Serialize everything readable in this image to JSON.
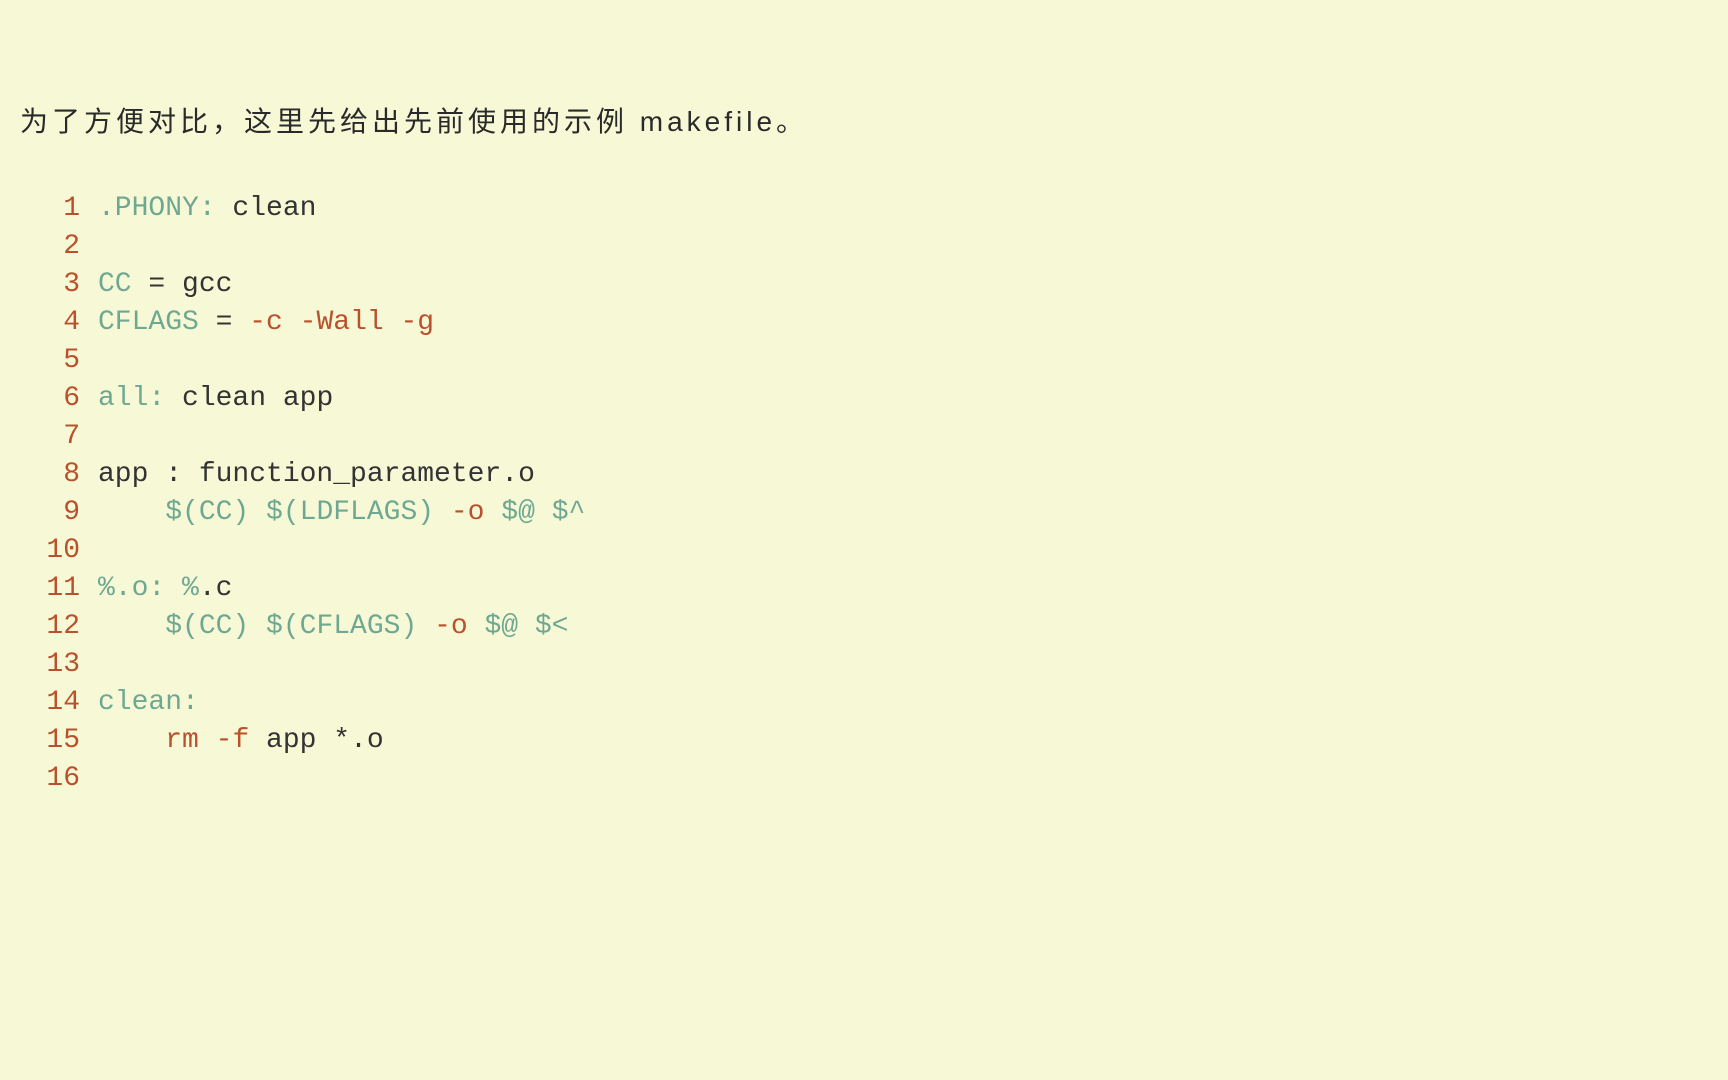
{
  "intro": "为了方便对比，这里先给出先前使用的示例 makefile。",
  "code": {
    "lines": [
      {
        "no": "1",
        "tokens": [
          {
            "t": ".PHONY:",
            "c": "tok-target"
          },
          {
            "t": " clean",
            "c": "tok-default"
          }
        ]
      },
      {
        "no": "2",
        "tokens": [
          {
            "t": "",
            "c": "tok-default"
          }
        ]
      },
      {
        "no": "3",
        "tokens": [
          {
            "t": "CC",
            "c": "tok-target"
          },
          {
            "t": " = gcc",
            "c": "tok-default"
          }
        ]
      },
      {
        "no": "4",
        "tokens": [
          {
            "t": "CFLAGS",
            "c": "tok-target"
          },
          {
            "t": " = ",
            "c": "tok-default"
          },
          {
            "t": "-c -Wall -g",
            "c": "tok-flag"
          }
        ]
      },
      {
        "no": "5",
        "tokens": [
          {
            "t": "",
            "c": "tok-default"
          }
        ]
      },
      {
        "no": "6",
        "tokens": [
          {
            "t": "all:",
            "c": "tok-target"
          },
          {
            "t": " clean app",
            "c": "tok-default"
          }
        ]
      },
      {
        "no": "7",
        "tokens": [
          {
            "t": "",
            "c": "tok-default"
          }
        ]
      },
      {
        "no": "8",
        "tokens": [
          {
            "t": "app : function_parameter.o",
            "c": "tok-default"
          }
        ]
      },
      {
        "no": "9",
        "tokens": [
          {
            "t": "    ",
            "c": "tok-default"
          },
          {
            "t": "$(CC) $(LDFLAGS) ",
            "c": "tok-target"
          },
          {
            "t": "-o",
            "c": "tok-flag"
          },
          {
            "t": " $@ $^",
            "c": "tok-target"
          }
        ]
      },
      {
        "no": "10",
        "tokens": [
          {
            "t": "",
            "c": "tok-default"
          }
        ]
      },
      {
        "no": "11",
        "tokens": [
          {
            "t": "%.o: %",
            "c": "tok-target"
          },
          {
            "t": ".c",
            "c": "tok-default"
          }
        ]
      },
      {
        "no": "12",
        "tokens": [
          {
            "t": "    ",
            "c": "tok-default"
          },
          {
            "t": "$(CC) $(CFLAGS) ",
            "c": "tok-target"
          },
          {
            "t": "-o",
            "c": "tok-flag"
          },
          {
            "t": " $@ $<",
            "c": "tok-target"
          }
        ]
      },
      {
        "no": "13",
        "tokens": [
          {
            "t": "",
            "c": "tok-default"
          }
        ]
      },
      {
        "no": "14",
        "tokens": [
          {
            "t": "clean:",
            "c": "tok-target"
          }
        ]
      },
      {
        "no": "15",
        "tokens": [
          {
            "t": "    ",
            "c": "tok-default"
          },
          {
            "t": "rm ",
            "c": "tok-rm"
          },
          {
            "t": "-f",
            "c": "tok-flag"
          },
          {
            "t": " app *.o",
            "c": "tok-default"
          }
        ]
      },
      {
        "no": "16",
        "tokens": [
          {
            "t": "",
            "c": "tok-default"
          }
        ]
      }
    ]
  }
}
